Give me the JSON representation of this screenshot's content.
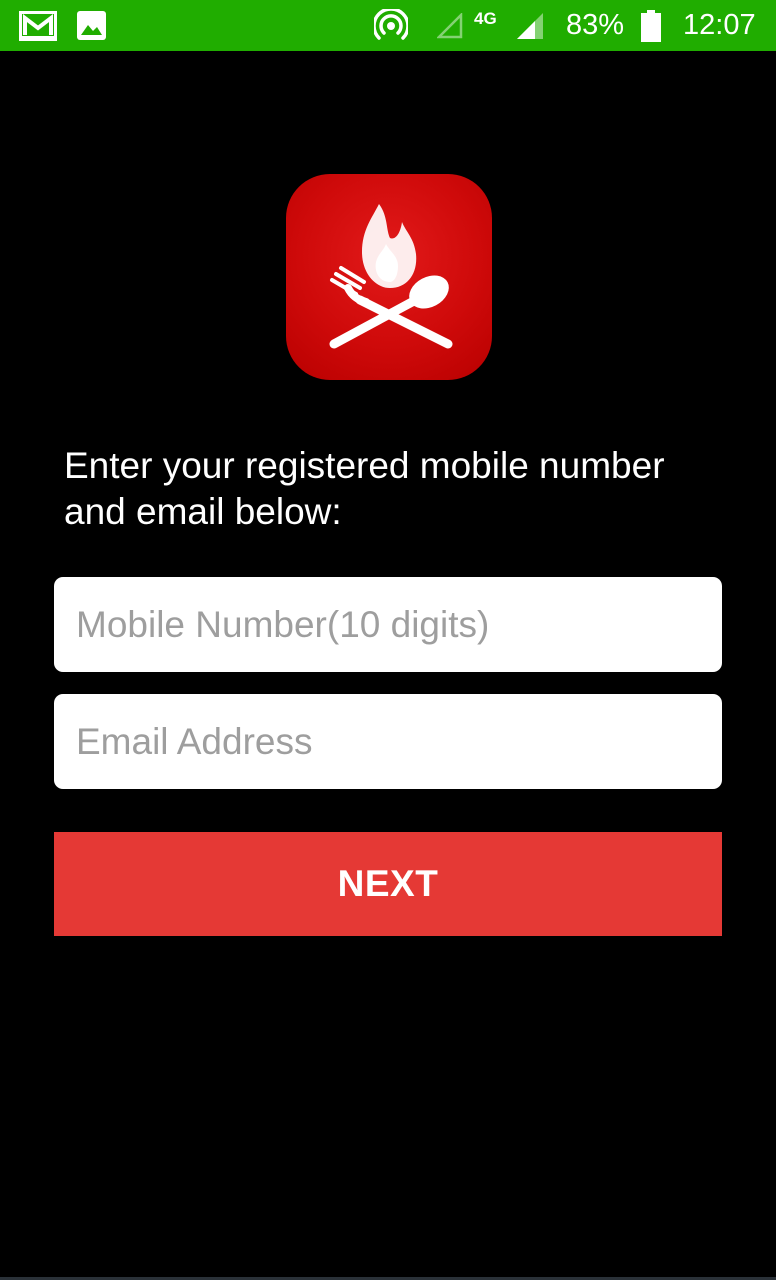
{
  "status_bar": {
    "background": "#20ad00",
    "network_type": "4G",
    "battery_percent": "83%",
    "time": "12:07",
    "icons": [
      "gmail-icon",
      "image-icon",
      "hotspot-icon",
      "signal-empty-icon",
      "signal-icon",
      "battery-icon"
    ]
  },
  "logo": {
    "icon": "flame-fork-spoon-logo",
    "color": "#cf0a0a"
  },
  "form": {
    "instruction": "Enter your registered mobile number and email below:",
    "mobile": {
      "value": "",
      "placeholder": "Mobile Number(10 digits)"
    },
    "email": {
      "value": "",
      "placeholder": "Email Address"
    },
    "next_label": "NEXT",
    "accent": "#e53935"
  }
}
